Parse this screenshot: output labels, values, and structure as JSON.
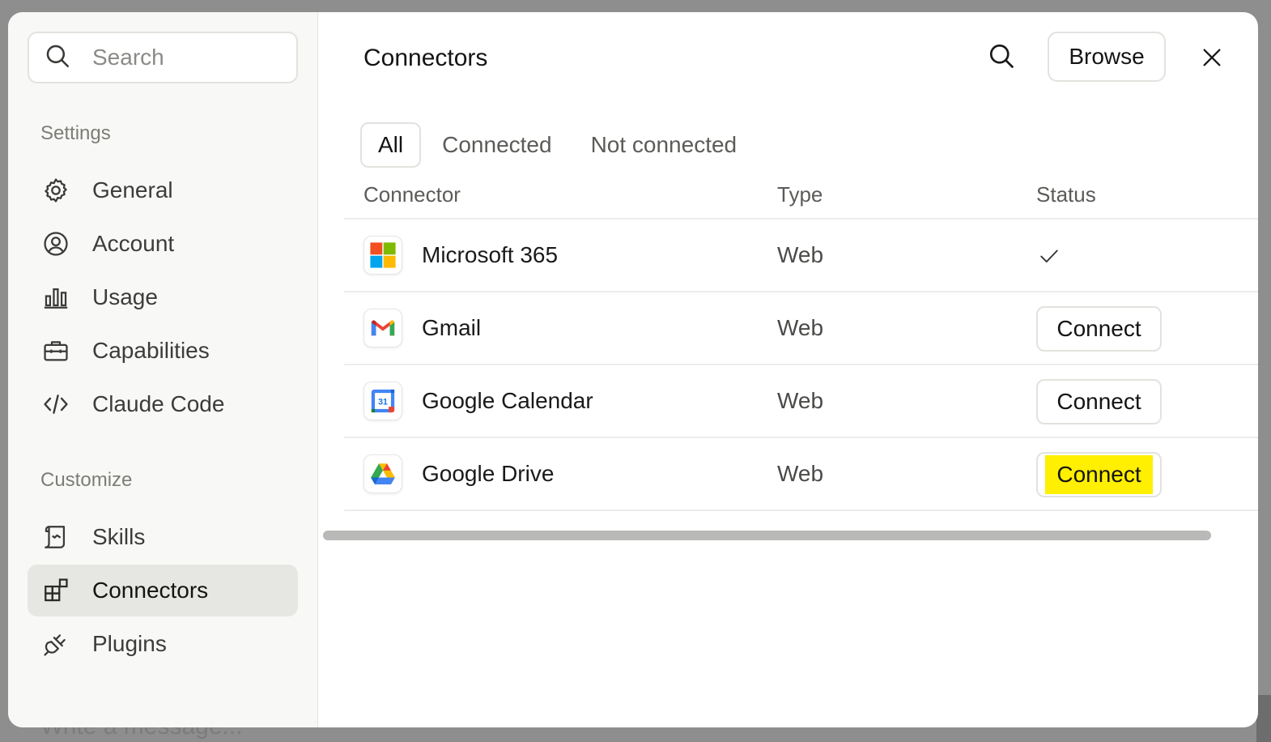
{
  "backdrop": {
    "composer_placeholder": "Write a message..."
  },
  "sidebar": {
    "search_placeholder": "Search",
    "settings_label": "Settings",
    "settings_items": [
      {
        "label": "General",
        "icon": "gear-icon"
      },
      {
        "label": "Account",
        "icon": "user-circle-icon"
      },
      {
        "label": "Usage",
        "icon": "bar-chart-icon"
      },
      {
        "label": "Capabilities",
        "icon": "briefcase-icon"
      },
      {
        "label": "Claude Code",
        "icon": "code-icon"
      }
    ],
    "customize_label": "Customize",
    "customize_items": [
      {
        "label": "Skills",
        "icon": "scroll-icon"
      },
      {
        "label": "Connectors",
        "icon": "connectors-icon",
        "active": true
      },
      {
        "label": "Plugins",
        "icon": "plug-icon"
      }
    ]
  },
  "main": {
    "title": "Connectors",
    "browse_label": "Browse",
    "tabs": [
      {
        "label": "All",
        "active": true
      },
      {
        "label": "Connected"
      },
      {
        "label": "Not connected"
      }
    ],
    "columns": {
      "connector": "Connector",
      "type": "Type",
      "status": "Status"
    },
    "rows": [
      {
        "name": "Microsoft 365",
        "type": "Web",
        "status": "connected",
        "icon": "microsoft-365-icon"
      },
      {
        "name": "Gmail",
        "type": "Web",
        "status_label": "Connect",
        "icon": "gmail-icon"
      },
      {
        "name": "Google Calendar",
        "type": "Web",
        "status_label": "Connect",
        "icon": "google-calendar-icon",
        "calendar_day": "31"
      },
      {
        "name": "Google Drive",
        "type": "Web",
        "status_label": "Connect",
        "icon": "google-drive-icon",
        "highlighted": true
      }
    ]
  },
  "colors": {
    "highlight": "#ffef00",
    "active_nav": "#e6e6e3"
  }
}
